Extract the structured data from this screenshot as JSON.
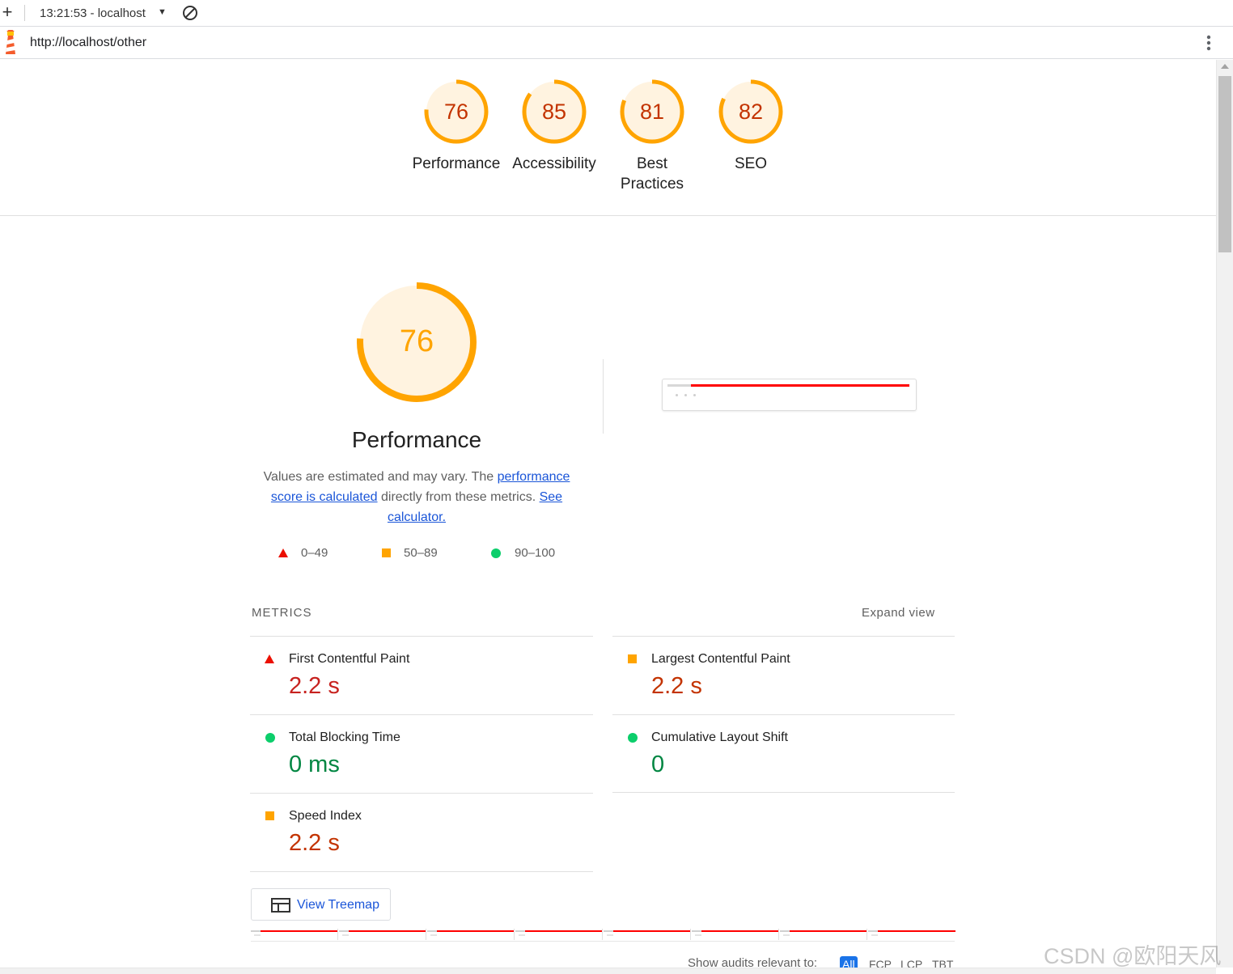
{
  "toolbar": {
    "new_icon": "plus-icon",
    "session_label": "13:21:53 - localhost",
    "dropdown_icon": "caret-down-icon",
    "clear_icon": "block-icon"
  },
  "urlbar": {
    "logo_icon": "lighthouse-icon",
    "url": "http://localhost/other",
    "menu_icon": "kebab-menu-icon"
  },
  "scores": [
    {
      "label": "Performance",
      "value": 76
    },
    {
      "label": "Accessibility",
      "value": 85
    },
    {
      "label": "Best Practices",
      "value": 81
    },
    {
      "label": "SEO",
      "value": 82
    }
  ],
  "colors": {
    "average_stroke": "#ffa400",
    "average_fill": "#fff3e0",
    "average_text": "#c33300",
    "fail": "#eb0f00",
    "pass": "#0cce6b",
    "link": "#1a55d8"
  },
  "performance": {
    "score": 76,
    "title": "Performance",
    "desc_prefix": "Values are estimated and may vary. The ",
    "desc_link1": "performance score is calculated",
    "desc_middle": " directly from these metrics. ",
    "desc_link2": "See calculator."
  },
  "legend": [
    {
      "range": "0–49",
      "shape": "triangle"
    },
    {
      "range": "50–89",
      "shape": "square"
    },
    {
      "range": "90–100",
      "shape": "circle"
    }
  ],
  "metrics": {
    "heading": "METRICS",
    "expand_label": "Expand view",
    "items": [
      {
        "title": "First Contentful Paint",
        "value": "2.2 s",
        "rating": "fail"
      },
      {
        "title": "Largest Contentful Paint",
        "value": "2.2 s",
        "rating": "average"
      },
      {
        "title": "Total Blocking Time",
        "value": "0 ms",
        "rating": "pass"
      },
      {
        "title": "Cumulative Layout Shift",
        "value": "0",
        "rating": "pass"
      },
      {
        "title": "Speed Index",
        "value": "2.2 s",
        "rating": "average"
      }
    ]
  },
  "treemap": {
    "label": "View Treemap",
    "icon": "treemap-icon"
  },
  "audit_filter": {
    "label": "Show audits relevant to:",
    "chips": [
      "All",
      "FCP",
      "LCP",
      "TBT"
    ],
    "active": "All"
  },
  "watermark": "CSDN @欧阳天风"
}
